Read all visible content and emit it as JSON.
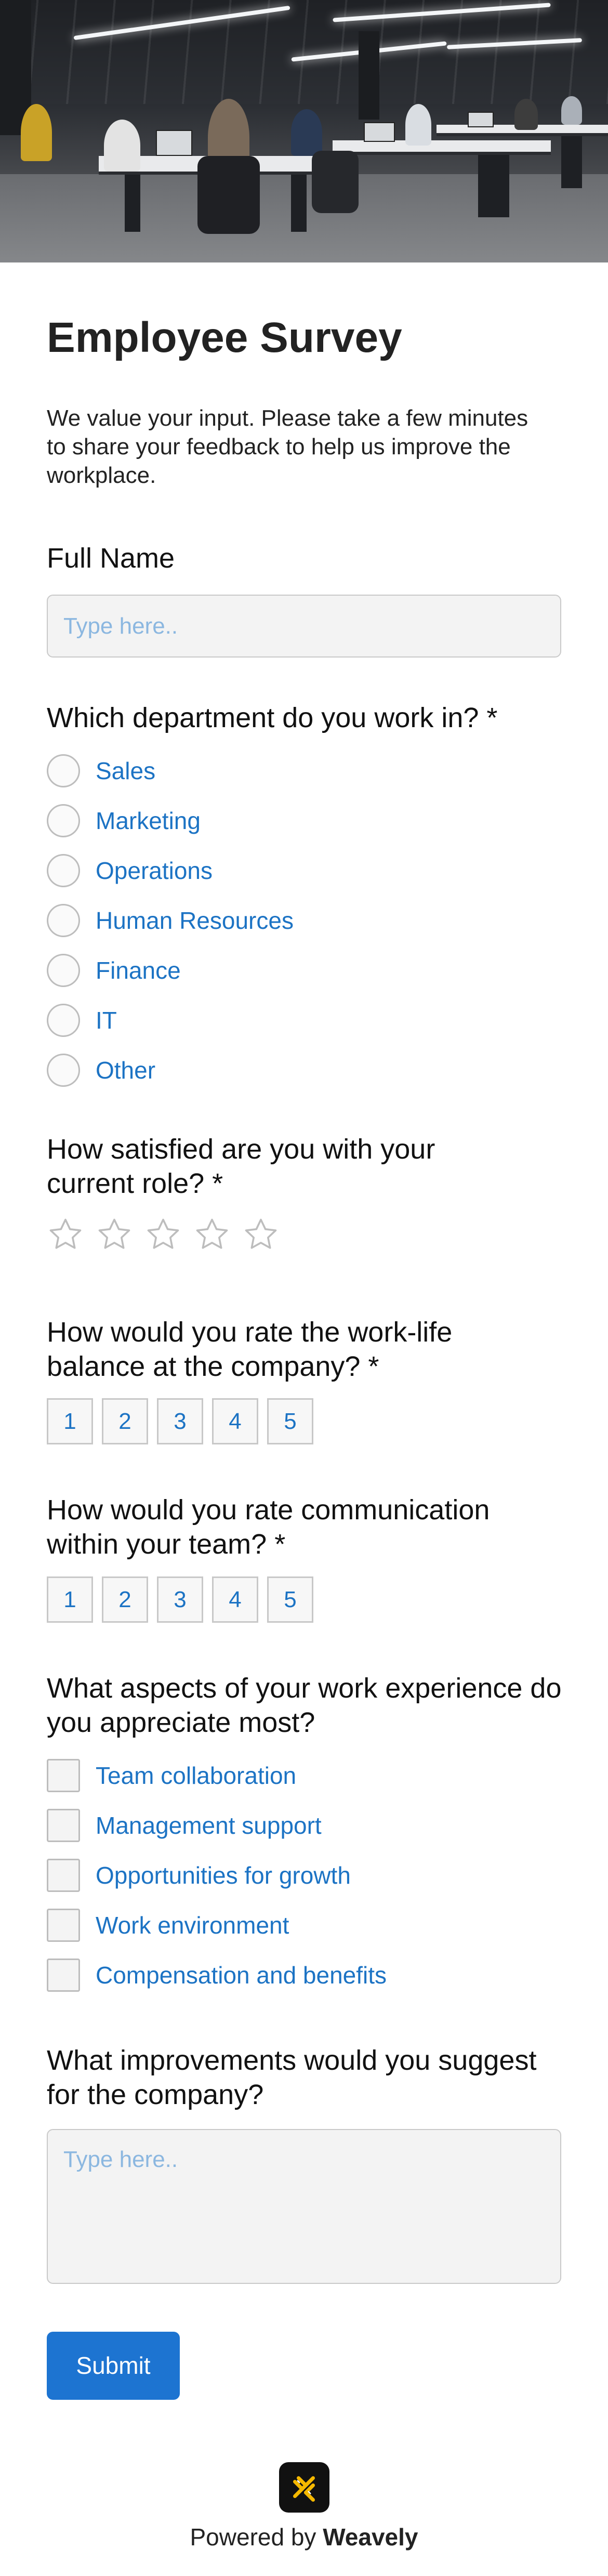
{
  "hero": {
    "alt_subject": "office-photo"
  },
  "survey": {
    "title": "Employee Survey",
    "intro": "We value your input. Please take a few minutes to share your feedback to help us improve the workplace."
  },
  "full_name": {
    "label": "Full Name",
    "placeholder": "Type here.."
  },
  "department": {
    "label": "Which department do you work in? *",
    "options": [
      "Sales",
      "Marketing",
      "Operations",
      "Human Resources",
      "Finance",
      "IT",
      "Other"
    ]
  },
  "satisfaction": {
    "label": "How satisfied are you with your current role? *",
    "max_stars": 5,
    "rating": 0
  },
  "work_life": {
    "label": "How would you rate the work-life balance at the company? *",
    "scale": [
      "1",
      "2",
      "3",
      "4",
      "5"
    ]
  },
  "communication": {
    "label": "How would you rate communication within your team? *",
    "scale": [
      "1",
      "2",
      "3",
      "4",
      "5"
    ]
  },
  "aspects": {
    "label": "What aspects of your work experience do you appreciate most?",
    "options": [
      "Team collaboration",
      "Management support",
      "Opportunities for growth",
      "Work environment",
      "Compensation and benefits"
    ]
  },
  "improvements": {
    "label": "What improvements would you suggest for the company?",
    "placeholder": "Type here.."
  },
  "submit": {
    "label": "Submit"
  },
  "footer": {
    "powered_prefix": "Powered by",
    "brand": "Weavely",
    "logo_icon": "weavely-logo-icon"
  },
  "colors": {
    "accent": "#1d74d1",
    "option_text": "#1c73c4",
    "placeholder": "#8bb7e0",
    "logo_yellow": "#f5b800"
  }
}
